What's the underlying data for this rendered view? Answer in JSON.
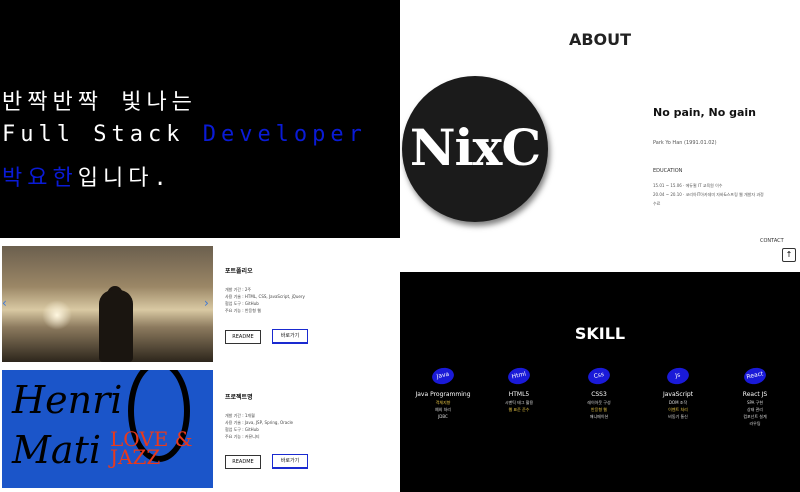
{
  "hero": {
    "line1": "반짝반짝 빛나는",
    "line2_a": "Full Stack ",
    "line2_b": "Developer",
    "line3_a": "박요한",
    "line3_b": "입니다."
  },
  "about": {
    "title": "ABOUT",
    "logo_text": "NixC",
    "motto": "No pain, No gain",
    "author": "Park Yo Han (1991.01.02)",
    "education_label": "EDUCATION",
    "education_1": "15.01 ~ 15.06 · 에듀윌 IT 교육원 이수",
    "education_2": "20.04 ~ 20.10 · 코리아IT아카데미 자바&스프링 웹 개발자 과정",
    "education_3": "수료",
    "contact": "CONTACT",
    "top_button": "↑"
  },
  "projects": [
    {
      "title": "포트폴리오",
      "desc": [
        "개발 기간 : 2주",
        "사용 기술 : HTML, CSS, JavaScript, jQuery",
        "협업 도구 : GitHub",
        "주요 기능 : 반응형 웹"
      ],
      "readme": "README",
      "link": "바로가기"
    },
    {
      "title": "프로젝트명",
      "desc": [
        "개발 기간 : 1개월",
        "사용 기술 : Java, JSP, Spring, Oracle",
        "협업 도구 : GitHub",
        "주요 기능 : 커뮤니티"
      ],
      "readme": "README",
      "link": "바로가기",
      "art_text_1": "Henri",
      "art_text_2": "Mati",
      "art_text_3": "LOVE &",
      "art_text_4": "JAZZ"
    }
  ],
  "skill": {
    "title": "SKILL",
    "items": [
      {
        "badge": "Java",
        "name": "Java Programming",
        "details": [
          "객체지향",
          "예외 처리",
          "JDBC"
        ]
      },
      {
        "badge": "Html",
        "name": "HTML5",
        "details": [
          "시맨틱 태그 활용",
          "웹 표준 준수"
        ]
      },
      {
        "badge": "Css",
        "name": "CSS3",
        "details": [
          "레이아웃 구성",
          "반응형 웹",
          "애니메이션"
        ]
      },
      {
        "badge": "Js",
        "name": "JavaScript",
        "details": [
          "DOM 조작",
          "이벤트 처리",
          "비동기 통신"
        ]
      },
      {
        "badge": "React",
        "name": "React JS",
        "details": [
          "SPA 구현",
          "상태 관리",
          "컴포넌트 설계",
          "라우팅"
        ]
      }
    ]
  }
}
